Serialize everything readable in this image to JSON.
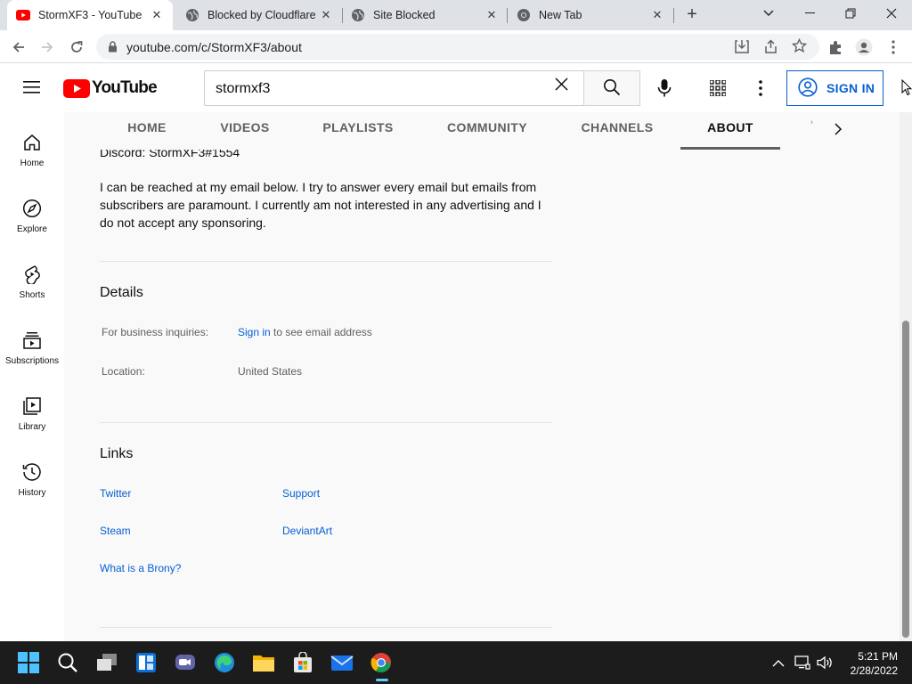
{
  "browser": {
    "tabs": [
      {
        "title": "StormXF3 - YouTube",
        "favicon": "youtube-icon",
        "active": true
      },
      {
        "title": "Blocked by Cloudflare",
        "favicon": "globe-icon",
        "active": false
      },
      {
        "title": "Site Blocked",
        "favicon": "globe-icon",
        "active": false
      },
      {
        "title": "New Tab",
        "favicon": "chrome-icon",
        "active": false
      }
    ],
    "url": "youtube.com/c/StormXF3/about"
  },
  "youtube": {
    "logo_text": "YouTube",
    "search_value": "stormxf3",
    "signin_label": "SIGN IN",
    "guide": [
      {
        "label": "Home",
        "icon": "home-icon"
      },
      {
        "label": "Explore",
        "icon": "explore-icon"
      },
      {
        "label": "Shorts",
        "icon": "shorts-icon"
      },
      {
        "label": "Subscriptions",
        "icon": "subscriptions-icon"
      },
      {
        "label": "Library",
        "icon": "library-icon"
      },
      {
        "label": "History",
        "icon": "history-icon"
      }
    ],
    "channel_tabs": [
      {
        "label": "HOME",
        "active": false
      },
      {
        "label": "VIDEOS",
        "active": false
      },
      {
        "label": "PLAYLISTS",
        "active": false
      },
      {
        "label": "COMMUNITY",
        "active": false
      },
      {
        "label": "CHANNELS",
        "active": false
      },
      {
        "label": "ABOUT",
        "active": true
      }
    ]
  },
  "about": {
    "discord_line": "Discord: StormXF3#1554",
    "description": "I can be reached at my email below. I try to answer every email but emails from subscribers are paramount. I currently am not interested in any advertising and I do not accept any sponsoring.",
    "details_heading": "Details",
    "business_label": "For business inquiries:",
    "signin_link": "Sign in",
    "email_suffix": " to see email address",
    "location_label": "Location:",
    "location_value": "United States",
    "links_heading": "Links",
    "links": [
      "Twitter",
      "Support",
      "Steam",
      "DeviantArt",
      "What is a Brony?"
    ]
  },
  "taskbar": {
    "time": "5:21 PM",
    "date": "2/28/2022"
  },
  "colors": {
    "youtube_red": "#ff0000",
    "link_blue": "#065fd4",
    "taskbar_bg": "#1c1c1c"
  }
}
